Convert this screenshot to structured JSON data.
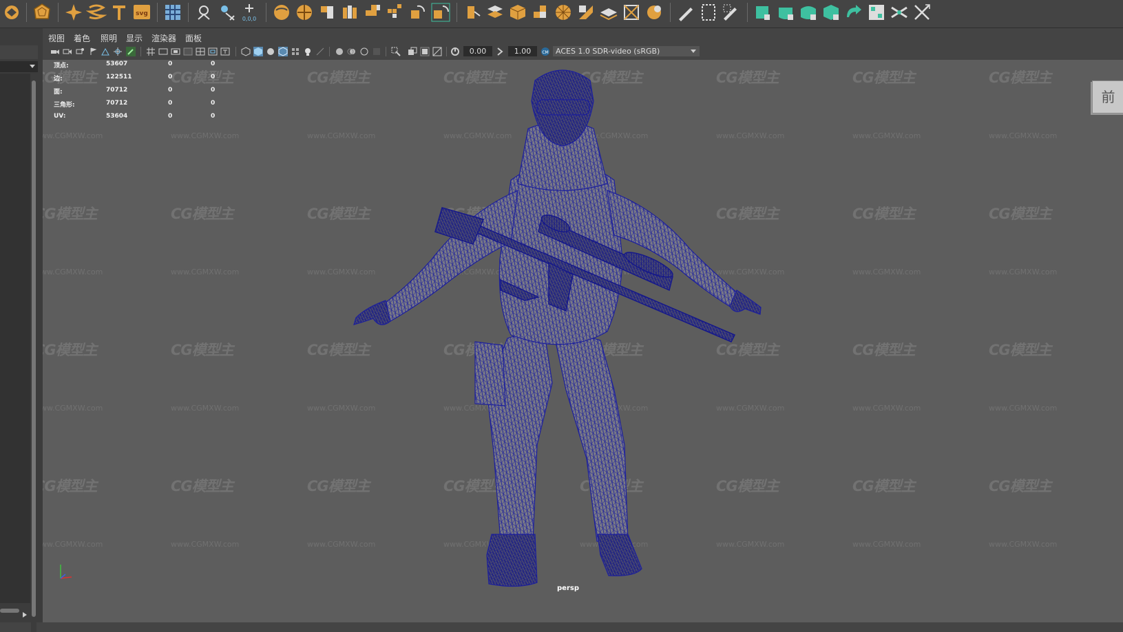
{
  "panel_menu": [
    "视图",
    "着色",
    "照明",
    "显示",
    "渲染器",
    "面板"
  ],
  "hud_stats": [
    {
      "label": "顶点:",
      "value": "53607",
      "sel": "0",
      "comp": "0"
    },
    {
      "label": "边:",
      "value": "122511",
      "sel": "0",
      "comp": "0"
    },
    {
      "label": "面:",
      "value": "70712",
      "sel": "0",
      "comp": "0"
    },
    {
      "label": "三角形:",
      "value": "70712",
      "sel": "0",
      "comp": "0"
    },
    {
      "label": "UV:",
      "value": "53604",
      "sel": "0",
      "comp": "0"
    }
  ],
  "toolbar": {
    "exposure": "0.00",
    "gamma": "1.00",
    "color_space": "ACES 1.0 SDR-video (sRGB)"
  },
  "shelf_icons": [
    "shelf-tool-icon",
    "polygon-icon",
    "star-icon",
    "helix-icon",
    "text-icon",
    "svg-icon",
    "grid-icon",
    "search-icon",
    "pivot-icon",
    "transform-icon",
    "sphere-icon",
    "cone-icon",
    "stack-icon",
    "cube-icon"
  ],
  "viewcube_label": "前",
  "camera_label": "persp",
  "watermark": "CG模型主",
  "watermark_url": "www.CGMXW.com",
  "colors": {
    "viewport_bg": "#5d5d5d",
    "wireframe": "#1c1f9c",
    "shelf_orange": "#e0a040",
    "shelf_green": "#3ec0a0"
  }
}
